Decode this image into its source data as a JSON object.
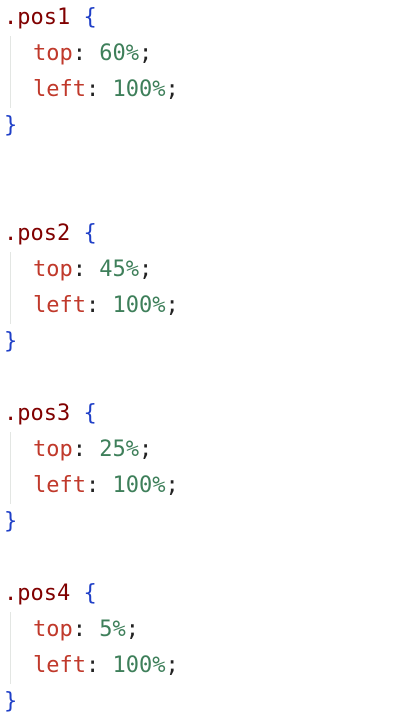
{
  "rules": [
    {
      "selector": ".pos1",
      "open_brace": "{",
      "close_brace": "}",
      "declarations": [
        {
          "property": "top",
          "value": "60%"
        },
        {
          "property": "left",
          "value": "100%"
        }
      ]
    },
    {
      "selector": ".pos2",
      "open_brace": "{",
      "close_brace": "}",
      "declarations": [
        {
          "property": "top",
          "value": "45%"
        },
        {
          "property": "left",
          "value": "100%"
        }
      ]
    },
    {
      "selector": ".pos3",
      "open_brace": "{",
      "close_brace": "}",
      "declarations": [
        {
          "property": "top",
          "value": "25%"
        },
        {
          "property": "left",
          "value": "100%"
        }
      ]
    },
    {
      "selector": ".pos4",
      "open_brace": "{",
      "close_brace": "}",
      "declarations": [
        {
          "property": "top",
          "value": "5%"
        },
        {
          "property": "left",
          "value": "100%"
        }
      ]
    }
  ],
  "tokens": {
    "colon": ":",
    "semicolon": ";"
  }
}
